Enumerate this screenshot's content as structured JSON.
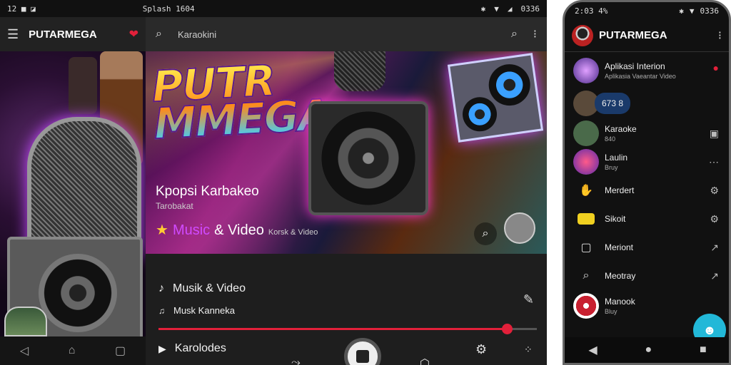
{
  "tablet": {
    "status": {
      "left": "12 ■ ◪",
      "center": "Splash 1604",
      "right": "0336"
    },
    "left_panel": {
      "app_name": "PUTARMEGA"
    },
    "search": {
      "placeholder": "Karaokini"
    },
    "hero": {
      "logo_line1": "PUTR",
      "logo_line2": "MMEGA",
      "title": "Kpopsi Karbakeo",
      "subtitle": "Tarobakat",
      "media_label_1": "Music",
      "media_label_2": "& Video",
      "media_label_3": "Korsk & Video"
    },
    "rows": {
      "row1": "Musik & Video",
      "row2": "Musk Kanneka",
      "row3": "Karolodes"
    },
    "progress": 0.92
  },
  "phone": {
    "status": {
      "left": "2:03 4%",
      "right": "0336"
    },
    "app_name": "PUTARMEGA",
    "items": [
      {
        "title": "Aplikasi Interion",
        "subtitle": "Aplikasia Vaeantar Video"
      },
      {
        "title": "673 8",
        "subtitle": ""
      },
      {
        "title": "Karaoke",
        "subtitle": "840"
      },
      {
        "title": "Laulin",
        "subtitle": "Bruy"
      },
      {
        "title": "Merdert",
        "subtitle": ""
      },
      {
        "title": "Sikoit",
        "subtitle": ""
      },
      {
        "title": "Meriont",
        "subtitle": ""
      },
      {
        "title": "Meotray",
        "subtitle": ""
      },
      {
        "title": "Manook",
        "subtitle": "Bluy"
      }
    ]
  }
}
